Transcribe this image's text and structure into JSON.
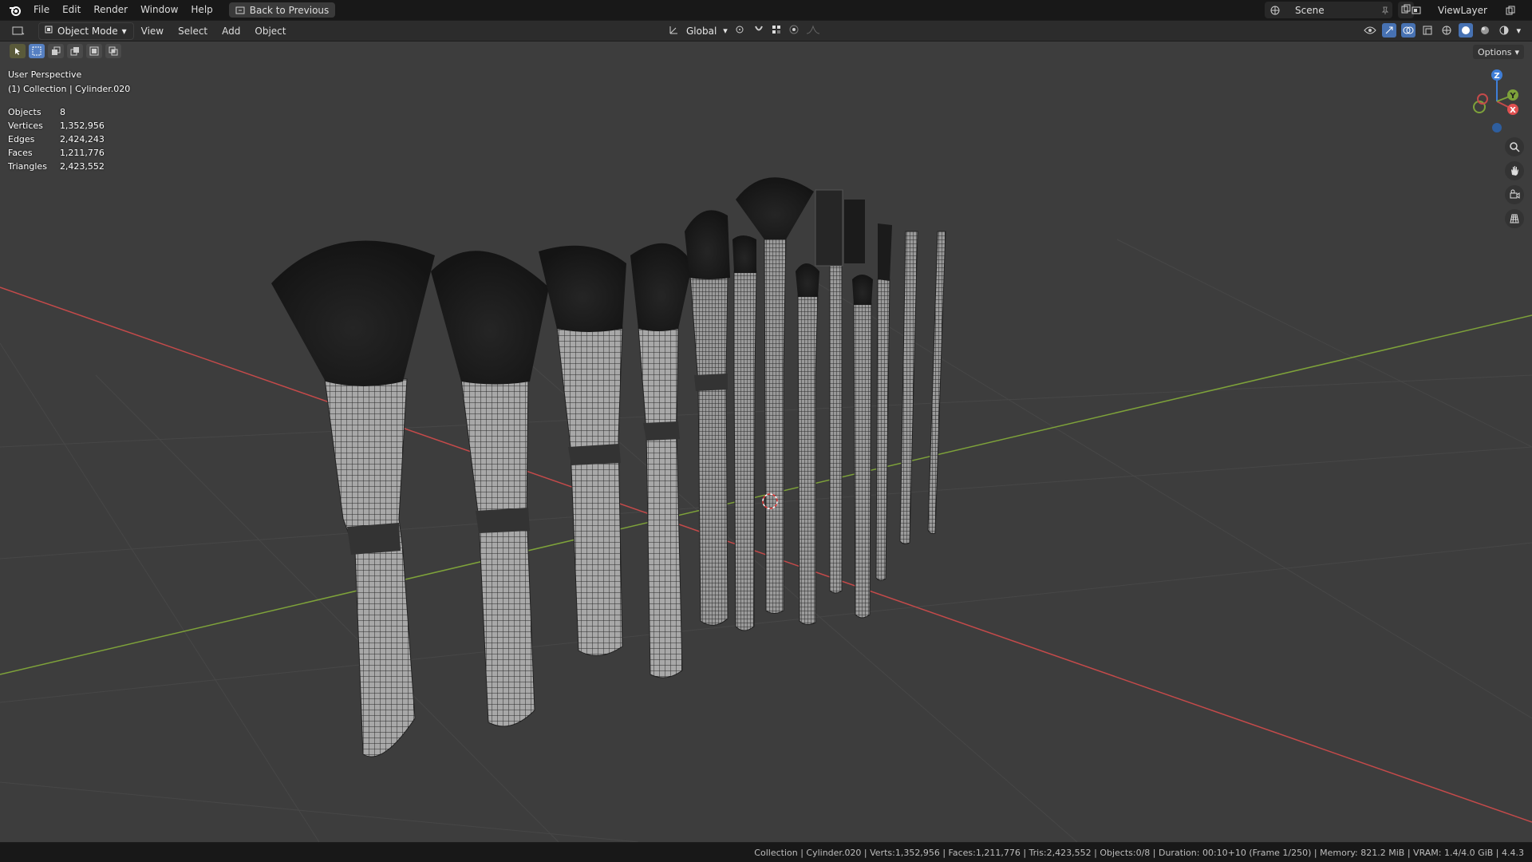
{
  "topbar": {
    "menus": [
      "File",
      "Edit",
      "Render",
      "Window",
      "Help"
    ],
    "back_label": "Back to Previous",
    "scene_label": "Scene",
    "viewlayer_label": "ViewLayer"
  },
  "header": {
    "mode": "Object Mode",
    "menus": [
      "View",
      "Select",
      "Add",
      "Object"
    ],
    "orientation": "Global"
  },
  "viewport": {
    "perspective": "User Perspective",
    "collection": "(1) Collection | Cylinder.020",
    "stats": [
      {
        "label": "Objects",
        "value": "8"
      },
      {
        "label": "Vertices",
        "value": "1,352,956"
      },
      {
        "label": "Edges",
        "value": "2,424,243"
      },
      {
        "label": "Faces",
        "value": "1,211,776"
      },
      {
        "label": "Triangles",
        "value": "2,423,552"
      }
    ],
    "options_label": "Options",
    "gizmo": {
      "z": "Z",
      "y": "Y",
      "x": "X"
    }
  },
  "status": {
    "text": "Collection | Cylinder.020 | Verts:1,352,956 | Faces:1,211,776 | Tris:2,423,552 | Objects:0/8 | Duration: 00:10+10 (Frame 1/250) | Memory: 821.2 MiB | VRAM: 1.4/4.0 GiB | 4.4.3"
  },
  "colors": {
    "x_axis": "#c44a4a",
    "y_axis": "#7ea23a",
    "z_axis": "#3f7ed8",
    "accent": "#5680c2"
  }
}
